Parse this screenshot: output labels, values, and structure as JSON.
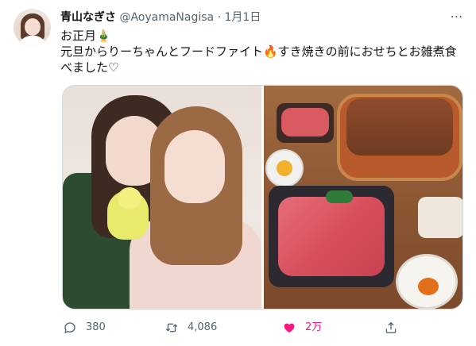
{
  "tweet": {
    "author": {
      "name": "青山なぎさ",
      "handle": "@AoyamaNagisa",
      "date": "1月1日",
      "dot": "·"
    },
    "text_lines": [
      "お正月🎍",
      "元旦からりーちゃんとフードファイト🔥すき焼きの前におせちとお雑煮食",
      "べました♡"
    ],
    "actions": {
      "reply_count": "380",
      "retweet_count": "4,086",
      "like_count": "2万"
    },
    "icons": {
      "more": "more-icon",
      "reply": "reply-icon",
      "retweet": "retweet-icon",
      "like": "heart-icon",
      "share": "share-icon"
    },
    "colors": {
      "primary_text": "#0f1419",
      "secondary_text": "#536471",
      "like_pink": "#f91880",
      "border": "#cfd9de"
    }
  }
}
